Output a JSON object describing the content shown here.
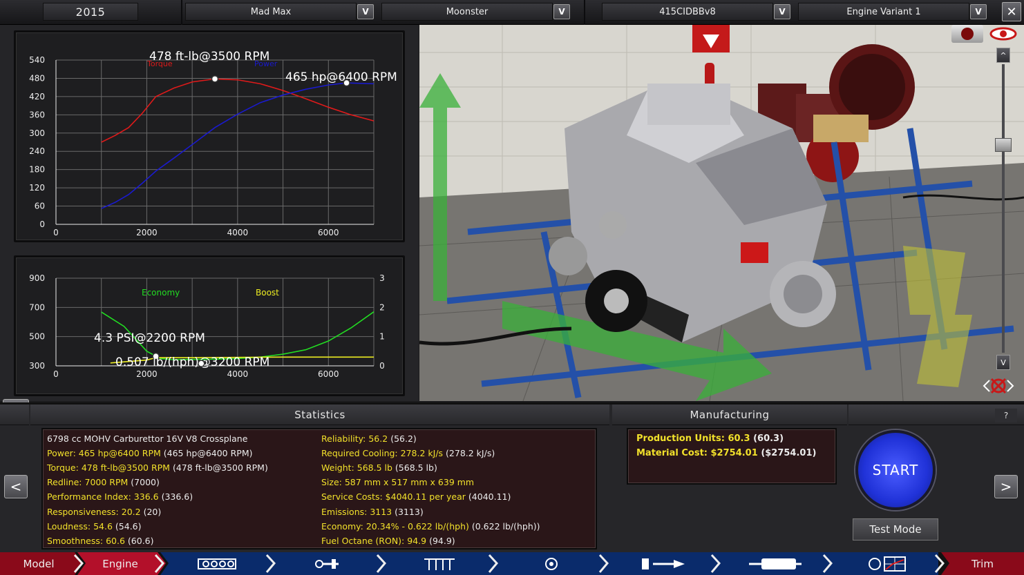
{
  "topbar": {
    "year": "2015",
    "family": "Mad Max",
    "variant_model": "Moonster",
    "engine_family": "415CIDBBv8",
    "engine_variant": "Engine Variant 1",
    "dropdown_glyph": "V",
    "close_glyph": "✕"
  },
  "chart_data": [
    {
      "type": "line",
      "title": "",
      "series": [
        {
          "name": "Torque",
          "color": "#e01a1a",
          "x": [
            1000,
            1300,
            1600,
            1900,
            2200,
            2600,
            3000,
            3500,
            4000,
            4500,
            5000,
            5500,
            6000,
            6500,
            7000
          ],
          "y": [
            270,
            292,
            318,
            365,
            420,
            448,
            468,
            478,
            475,
            462,
            440,
            413,
            385,
            360,
            340
          ]
        },
        {
          "name": "Power",
          "color": "#1a1ad0",
          "x": [
            1000,
            1300,
            1600,
            1900,
            2200,
            2600,
            3000,
            3500,
            4000,
            4500,
            5000,
            5500,
            6000,
            6400,
            7000
          ],
          "y": [
            52,
            72,
            98,
            135,
            175,
            218,
            262,
            318,
            362,
            400,
            425,
            444,
            458,
            465,
            462
          ]
        }
      ],
      "xlim": [
        0,
        7000
      ],
      "ylim": [
        0,
        540
      ],
      "xticks": [
        0,
        2000,
        4000,
        6000
      ],
      "yticks": [
        0,
        60,
        120,
        180,
        240,
        300,
        360,
        420,
        480,
        540
      ],
      "annotations": [
        {
          "text": "478 ft-lb@3500 RPM",
          "x": 3500,
          "y": 478
        },
        {
          "text": "465 hp@6400 RPM",
          "x": 6400,
          "y": 465
        }
      ],
      "grid": true
    },
    {
      "type": "line",
      "title": "",
      "series": [
        {
          "name": "Economy",
          "color": "#22dd22",
          "axis": "left",
          "x": [
            1000,
            1500,
            2000,
            2300,
            2600,
            3000,
            3500,
            4000,
            4500,
            5000,
            5500,
            6000,
            6500,
            7000
          ],
          "y": [
            668,
            570,
            400,
            350,
            342,
            344,
            346,
            350,
            360,
            380,
            410,
            470,
            560,
            670
          ]
        },
        {
          "name": "Boost",
          "color": "#eeee22",
          "axis": "right",
          "x": [
            1200,
            2000,
            2200,
            3000,
            4000,
            5000,
            6000,
            7000
          ],
          "y": [
            0.1,
            0.2,
            0.28,
            0.28,
            0.29,
            0.3,
            0.3,
            0.3
          ]
        }
      ],
      "xlim": [
        0,
        7000
      ],
      "ylim_left": [
        300,
        900
      ],
      "ylim_right": [
        0,
        3
      ],
      "xticks": [
        0,
        2000,
        4000,
        6000
      ],
      "yticks_left": [
        300,
        500,
        700,
        900
      ],
      "yticks_right": [
        0,
        1,
        2,
        3
      ],
      "annotations": [
        {
          "text": "4.3 PSI@2200 RPM",
          "x": 2200,
          "y": 0.28
        },
        {
          "text": "0.507 lb/(hph)@3200 RPM",
          "x": 3200,
          "y": 0.08
        }
      ],
      "grid": true
    }
  ],
  "stats": {
    "header": "Statistics",
    "left": [
      {
        "label": "",
        "value": "6798 cc MOHV Carburettor 16V V8 Crossplane",
        "extra": ""
      },
      {
        "label": "Power:",
        "value": "465 hp@6400 RPM",
        "extra": "(465 hp@6400 RPM)"
      },
      {
        "label": "Torque:",
        "value": "478 ft-lb@3500 RPM",
        "extra": "(478 ft-lb@3500 RPM)"
      },
      {
        "label": "Redline:",
        "value": "7000 RPM",
        "extra": "(7000)"
      },
      {
        "label": "Performance Index:",
        "value": "336.6",
        "extra": "(336.6)"
      },
      {
        "label": "Responsiveness:",
        "value": "20.2",
        "extra": "(20)"
      },
      {
        "label": "Loudness:",
        "value": "54.6",
        "extra": "(54.6)"
      },
      {
        "label": "Smoothness:",
        "value": "60.6",
        "extra": "(60.6)"
      }
    ],
    "right": [
      {
        "label": "Reliability:",
        "value": "56.2",
        "extra": "(56.2)"
      },
      {
        "label": "Required Cooling:",
        "value": "278.2 kJ/s",
        "extra": "(278.2 kJ/s)"
      },
      {
        "label": "Weight:",
        "value": "568.5 lb",
        "extra": "(568.5 lb)"
      },
      {
        "label": "Size:",
        "value": "587 mm x 517 mm x 639 mm",
        "extra": ""
      },
      {
        "label": "Service Costs:",
        "value": "$4040.11 per year",
        "extra": "(4040.11)"
      },
      {
        "label": "Emissions:",
        "value": "3113",
        "extra": "(3113)"
      },
      {
        "label": "Economy:",
        "value": "20.34% - 0.622 lb/(hph)",
        "extra": "(0.622 lb/(hph))"
      },
      {
        "label": "Fuel Octane (RON):",
        "value": "94.9",
        "extra": "(94.9)"
      }
    ]
  },
  "manufacturing": {
    "header": "Manufacturing",
    "production_units": "Production Units: 60.3",
    "production_units_extra": "(60.3)",
    "material_cost": "Material Cost: $2754.01",
    "material_cost_extra": "($2754.01)"
  },
  "controls": {
    "start": "START",
    "test_mode": "Test Mode",
    "help": "?",
    "prev": "<",
    "next": ">"
  },
  "nav": {
    "model": "Model",
    "engine": "Engine",
    "trim": "Trim",
    "active": "Engine"
  },
  "viewport": {
    "up_glyph": "^",
    "down_glyph": "V"
  },
  "colors": {
    "accent_red": "#c8102e",
    "stat_yellow": "#f2e12b",
    "start_blue": "#2032d8"
  }
}
